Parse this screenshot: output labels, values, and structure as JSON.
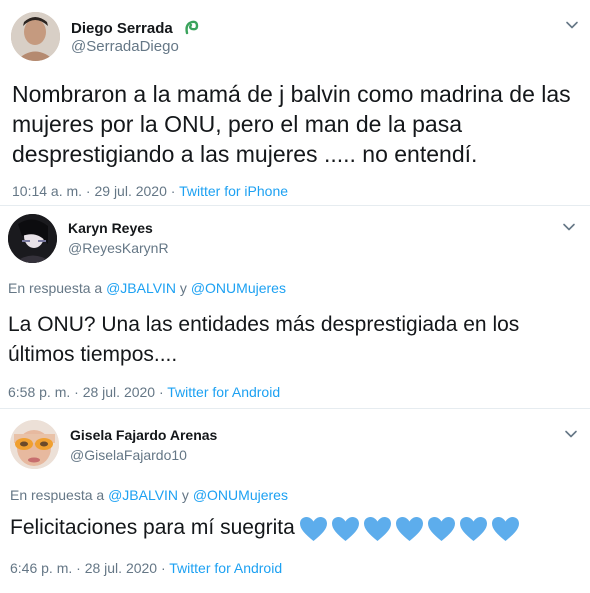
{
  "tweets": [
    {
      "name": "Diego Serrada",
      "handle": "@SerradaDiego",
      "badge_icon": "plant-emoji-icon",
      "text": "Nombraron a la mamá de j balvin como madrina de las mujeres por la ONU, pero el man de la pasa desprestigiando a las mujeres ..... no entendí.",
      "time": "10:14 a. m. · 29 jul. 2020 · ",
      "source": "Twitter for iPhone"
    },
    {
      "name": "Karyn Reyes",
      "handle": "@ReyesKarynR",
      "reply_prefix": "En respuesta a ",
      "reply_user1": "@JBALVIN",
      "reply_and": " y ",
      "reply_user2": "@ONUMujeres",
      "text": "La ONU? Una las entidades más desprestigiada en los últimos tiempos....",
      "time": "6:58 p. m. · 28 jul. 2020 · ",
      "source": "Twitter for Android"
    },
    {
      "name": "Gisela Fajardo Arenas",
      "handle": "@GiselaFajardo10",
      "reply_prefix": "En respuesta a ",
      "reply_user1": "@JBALVIN",
      "reply_and": " y ",
      "reply_user2": "@ONUMujeres",
      "text": "Felicitaciones para mí suegrita",
      "emoji_icon": "blue-heart-icon",
      "emoji_count": 7,
      "time": "6:46 p. m. · 28 jul. 2020 · ",
      "source": "Twitter for Android"
    }
  ],
  "colors": {
    "link": "#1da1f2",
    "secondary": "#657786",
    "heart": "#5dadec",
    "divider": "#e6ecf0"
  }
}
